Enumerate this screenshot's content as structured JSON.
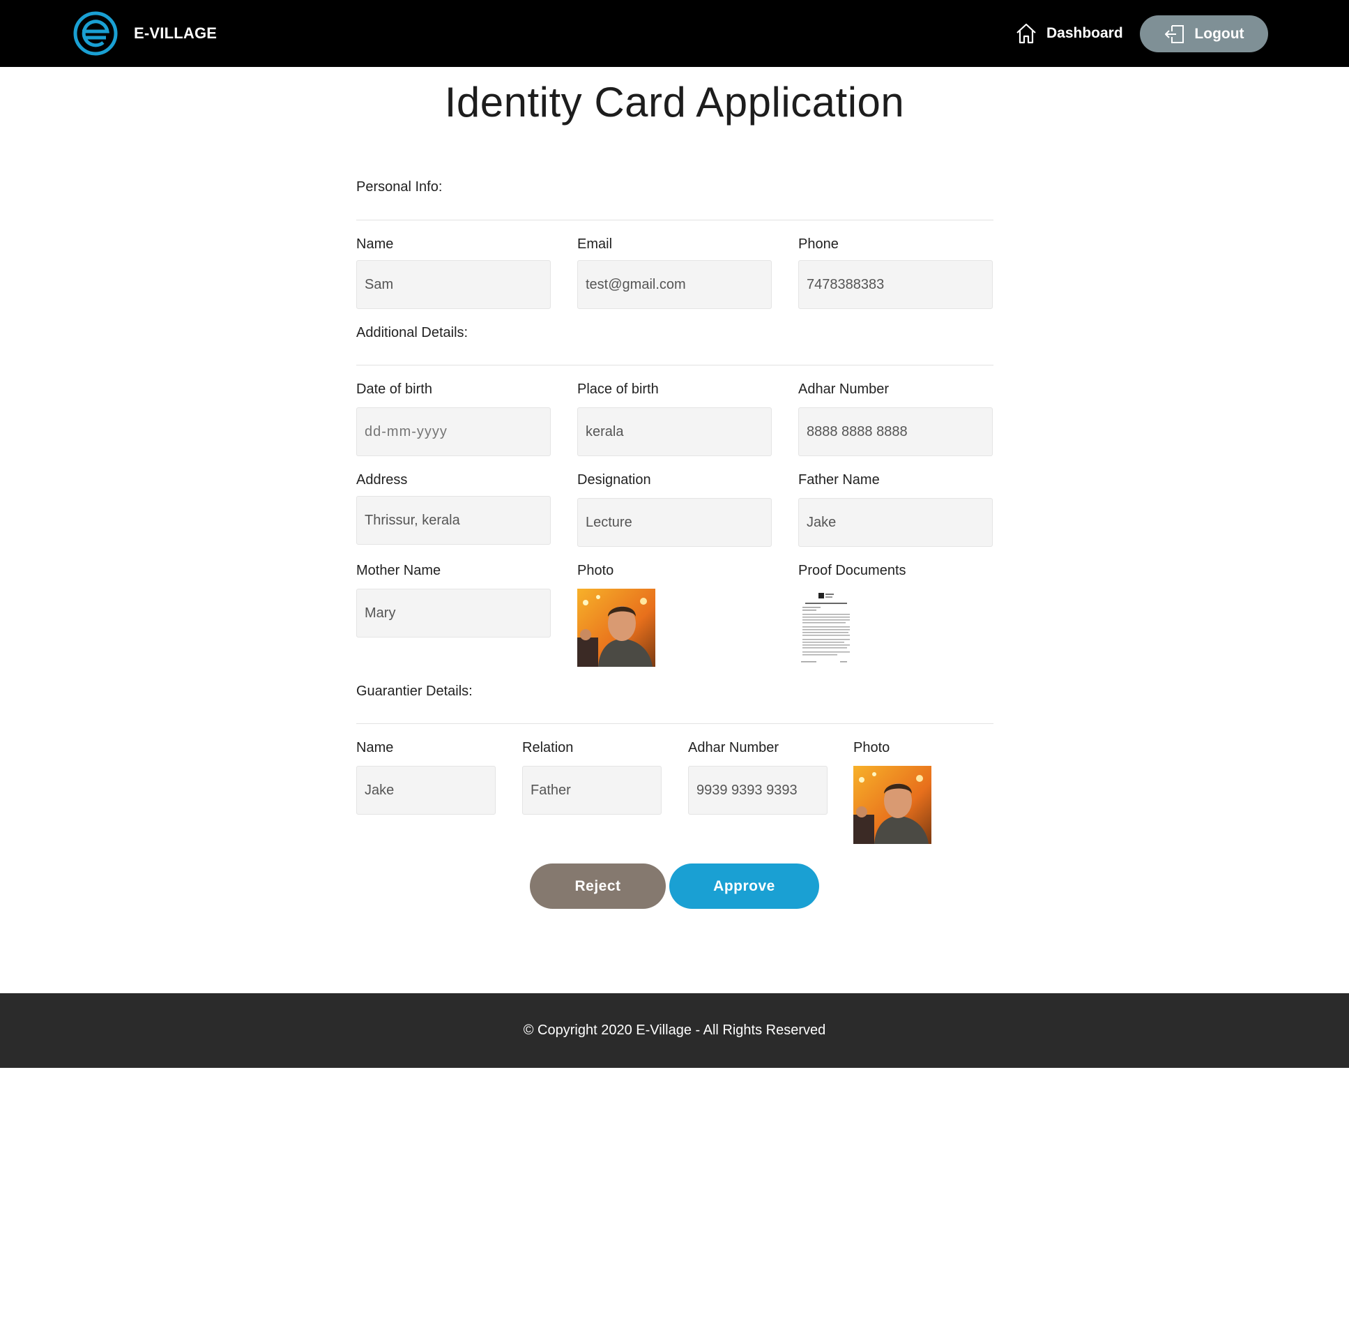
{
  "header": {
    "brand": "E-VILLAGE",
    "nav_dashboard": "Dashboard",
    "logout": "Logout"
  },
  "title": "Identity Card Application",
  "personal": {
    "heading": "Personal Info:",
    "name_label": "Name",
    "name_value": "Sam",
    "email_label": "Email",
    "email_value": "test@gmail.com",
    "phone_label": "Phone",
    "phone_value": "7478388383"
  },
  "additional": {
    "heading": "Additional Details:",
    "dob_label": "Date of birth",
    "dob_placeholder": "dd-mm-yyyy",
    "pob_label": "Place of birth",
    "pob_value": "kerala",
    "adhar_label": "Adhar Number",
    "adhar_value": "8888 8888 8888",
    "address_label": "Address",
    "address_value": "Thrissur, kerala",
    "designation_label": "Designation",
    "designation_value": "Lecture",
    "father_label": "Father Name",
    "father_value": "Jake",
    "mother_label": "Mother Name",
    "mother_value": "Mary",
    "photo_label": "Photo",
    "proof_label": "Proof Documents"
  },
  "guarantor": {
    "heading": "Guarantier Details:",
    "name_label": "Name",
    "name_value": "Jake",
    "relation_label": "Relation",
    "relation_value": "Father",
    "adhar_label": "Adhar Number",
    "adhar_value": "9939 9393 9393",
    "photo_label": "Photo"
  },
  "actions": {
    "reject": "Reject",
    "approve": "Approve"
  },
  "footer": {
    "copyright": "© Copyright 2020 E-Village - All Rights Reserved"
  },
  "colors": {
    "header_bg": "#000000",
    "logo_accent": "#1aa0d3",
    "logout_bg": "#7f9096",
    "reject_bg": "#85796f",
    "approve_bg": "#1aa0d3",
    "footer_bg": "#2b2b2b"
  }
}
